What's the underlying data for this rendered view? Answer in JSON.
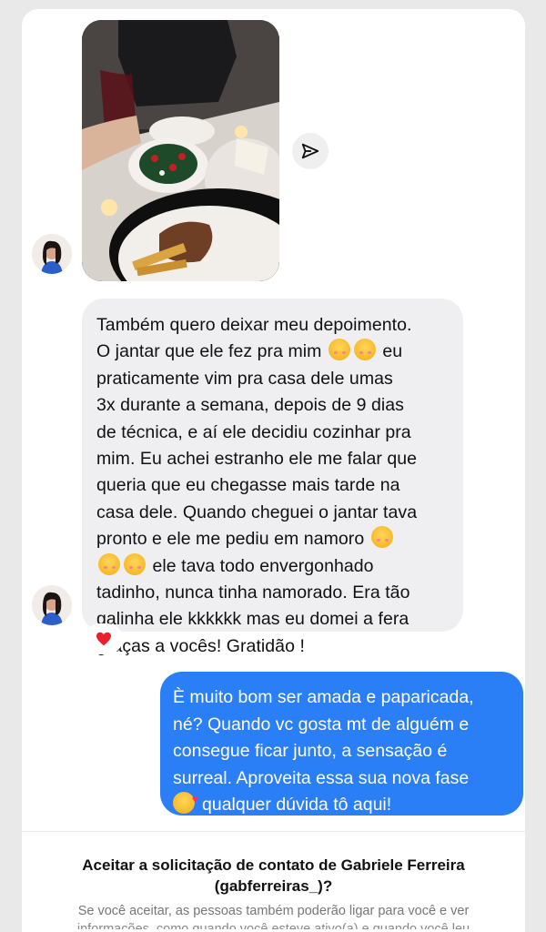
{
  "thread": {
    "shared_image_alt": "",
    "incoming_message": {
      "lines": [
        "Também quero deixar meu depoimento.",
        "O jantar que ele fez pra mim",
        "eu",
        "praticamente vim pra casa dele umas",
        "3x durante a semana, depois de 9 dias",
        "de técnica, e aí ele decidiu cozinhar pra",
        "mim. Eu achei estranho ele me falar que",
        "queria que eu chegasse mais tarde na",
        "casa dele. Quando cheguei o jantar tava",
        "pronto e ele me pediu em namoro",
        "ele tava todo envergonhado",
        "tadinho, nunca tinha namorado. Era tão",
        "galinha ele kkkkkk mas eu domei a fera",
        "graças a vocês! Gratidão !"
      ],
      "reaction": "❤️"
    },
    "outgoing_message": {
      "lines": [
        "È muito bom ser amada e paparicada,",
        "né? Quando vc gosta mt de alguém e",
        "consegue ficar junto, a sensação é",
        "surreal. Aproveita essa sua nova fase",
        "qualquer dúvida tô aqui!"
      ]
    }
  },
  "request": {
    "title": "Aceitar a solicitação de contato de Gabriele Ferreira (gabferreiras_)?",
    "subtitle": "Se você aceitar, as pessoas também poderão ligar para você e ver",
    "subtitle_cut": "informações, como quando você esteve ativo(a) e quando você leu"
  },
  "icons": {
    "send": "paper-plane-icon",
    "reaction": "heart-icon"
  },
  "colors": {
    "outgoing_bubble": "#2a7ff6",
    "incoming_bubble": "#efeff2",
    "heart": "#e8202f"
  }
}
